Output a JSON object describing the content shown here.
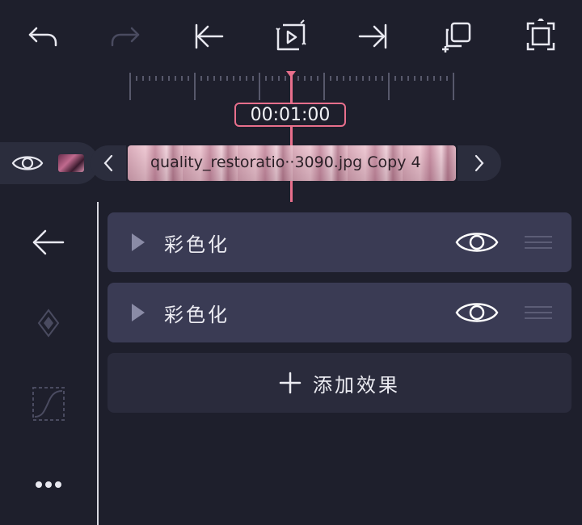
{
  "toolbar": {
    "buttons": [
      {
        "name": "undo",
        "icon": "undo-icon",
        "enabled": true
      },
      {
        "name": "redo",
        "icon": "redo-icon",
        "enabled": false
      },
      {
        "name": "jump-to-start",
        "icon": "skip-to-start-icon",
        "enabled": true
      },
      {
        "name": "play-loop",
        "icon": "play-loop-icon",
        "enabled": true
      },
      {
        "name": "jump-to-end",
        "icon": "skip-to-end-icon",
        "enabled": true
      },
      {
        "name": "duplicate",
        "icon": "duplicate-add-icon",
        "enabled": true
      },
      {
        "name": "fullscreen",
        "icon": "fullscreen-icon",
        "enabled": true
      }
    ]
  },
  "timeline": {
    "timecode": "00:01:00",
    "clip_label": "quality_restoratio··3090.jpg Copy 4"
  },
  "sidebar": {
    "items": [
      {
        "name": "back",
        "icon": "back-arrow-icon",
        "enabled": true
      },
      {
        "name": "keyframe",
        "icon": "keyframe-diamond-icon",
        "enabled": false
      },
      {
        "name": "curve",
        "icon": "curve-graph-icon",
        "enabled": false
      },
      {
        "name": "more",
        "icon": "more-dots-icon",
        "enabled": true
      }
    ]
  },
  "effects": {
    "items": [
      {
        "label": "彩色化",
        "visible": true
      },
      {
        "label": "彩色化",
        "visible": true
      }
    ],
    "add_label": "添加效果"
  },
  "colors": {
    "background": "#1e1f2c",
    "accent": "#e86f8c",
    "row": "#3a3b54",
    "disabled": "#4a4b60",
    "icon": "#e8e8f0"
  }
}
